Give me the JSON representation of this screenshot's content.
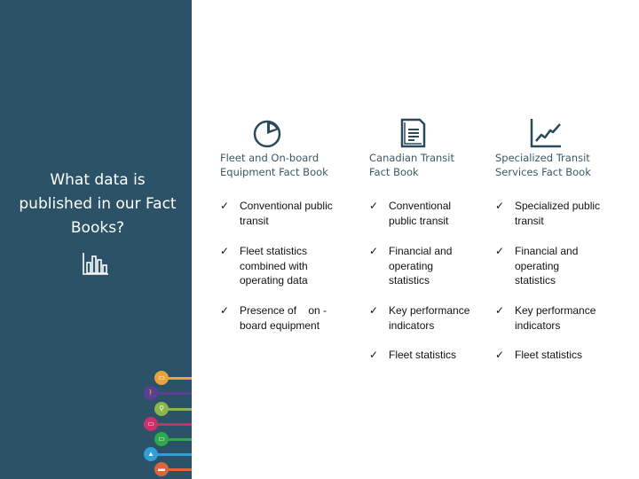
{
  "sidebar": {
    "title": "What data is published in our Fact Books?",
    "title_icon": "bar-chart-icon",
    "transit_modes": [
      {
        "icon": "bus-icon",
        "color": "#e8a33a",
        "glyph": "▭"
      },
      {
        "icon": "walking-icon",
        "color": "#5b3f96",
        "glyph": "🚶"
      },
      {
        "icon": "bicycle-icon",
        "color": "#8bb54a",
        "glyph": "⚲"
      },
      {
        "icon": "streetcar-icon",
        "color": "#cc2f6a",
        "glyph": "▭"
      },
      {
        "icon": "train-icon",
        "color": "#2eaa4a",
        "glyph": "▭"
      },
      {
        "icon": "ferry-icon",
        "color": "#2f9fd8",
        "glyph": "▲"
      },
      {
        "icon": "car-icon",
        "color": "#e0643a",
        "glyph": "▬"
      }
    ]
  },
  "columns": [
    {
      "icon": "pie-chart-icon",
      "title_line1": "Fleet and On-board",
      "title_line2": "Equipment Fact Book",
      "bullets": [
        "Conventional public transit",
        "Fleet statistics combined with operating data",
        "Presence of    on -board equipment"
      ]
    },
    {
      "icon": "document-icon",
      "title_line1": "Canadian Transit",
      "title_line2": "Fact Book",
      "bullets": [
        "Conventional public transit",
        "Financial and operating statistics",
        "Key performance indicators",
        "Fleet statistics"
      ]
    },
    {
      "icon": "line-chart-icon",
      "title_line1": "Specialized Transit",
      "title_line2": "Services Fact Book",
      "bullets": [
        "Specialized public transit",
        "Financial and operating statistics",
        "Key performance indicators",
        "Fleet statistics"
      ]
    }
  ],
  "check_glyph": "✓",
  "colors": {
    "sidebar_bg": "#2b5266",
    "heading": "#3a5866",
    "icon_stroke": "#2b4a5c"
  }
}
